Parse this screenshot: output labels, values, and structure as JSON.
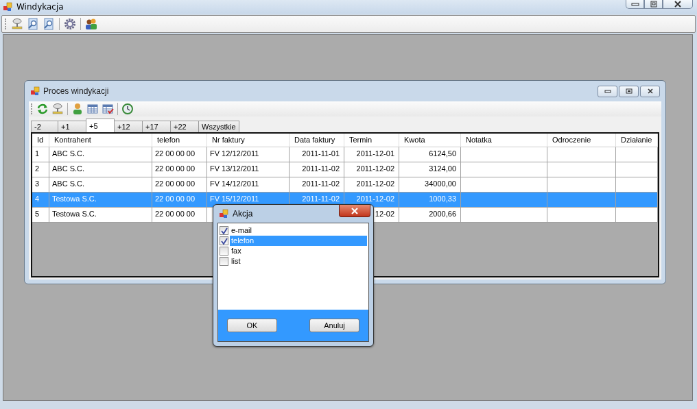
{
  "window": {
    "title": "Windykacja"
  },
  "child": {
    "title": "Proces windykacji",
    "tabs": [
      {
        "label": "-2",
        "selected": false
      },
      {
        "label": "+1",
        "selected": false
      },
      {
        "label": "+5",
        "selected": true
      },
      {
        "label": "+12",
        "selected": false
      },
      {
        "label": "+17",
        "selected": false
      },
      {
        "label": "+22",
        "selected": false
      },
      {
        "label": "Wszystkie",
        "selected": false
      }
    ],
    "table": {
      "columns": [
        "Id",
        "Kontrahent",
        "telefon",
        "Nr faktury",
        "Data faktury",
        "Termin",
        "Kwota",
        "Notatka",
        "Odroczenie",
        "Działanie"
      ],
      "rows": [
        {
          "selected": false,
          "cells": [
            "1",
            "ABC S.C.",
            "22 00 00 00",
            "FV 12/12/2011",
            "2011-11-01",
            "2011-12-01",
            "6124,50",
            "",
            "",
            ""
          ]
        },
        {
          "selected": false,
          "cells": [
            "2",
            "ABC S.C.",
            "22 00 00 00",
            "FV 13/12/2011",
            "2011-11-02",
            "2011-12-02",
            "3124,00",
            "",
            "",
            ""
          ]
        },
        {
          "selected": false,
          "cells": [
            "3",
            "ABC S.C.",
            "22 00 00 00",
            "FV 14/12/2011",
            "2011-11-02",
            "2011-12-02",
            "34000,00",
            "",
            "",
            ""
          ]
        },
        {
          "selected": true,
          "cells": [
            "4",
            "Testowa S.C.",
            "22 00 00 00",
            "FV 15/12/2011",
            "2011-11-02",
            "2011-12-02",
            "1000,33",
            "",
            "",
            ""
          ]
        },
        {
          "selected": false,
          "cells": [
            "5",
            "Testowa S.C.",
            "22 00 00 00",
            "",
            "",
            "12-02",
            "2000,66",
            "",
            "",
            ""
          ]
        }
      ]
    }
  },
  "dialog": {
    "title": "Akcja",
    "items": [
      {
        "label": "e-mail",
        "checked": true,
        "selected": false
      },
      {
        "label": "telefon",
        "checked": true,
        "selected": true
      },
      {
        "label": "fax",
        "checked": false,
        "selected": false
      },
      {
        "label": "list",
        "checked": false,
        "selected": false
      }
    ],
    "buttons": [
      "OK",
      "Anuluj"
    ]
  }
}
